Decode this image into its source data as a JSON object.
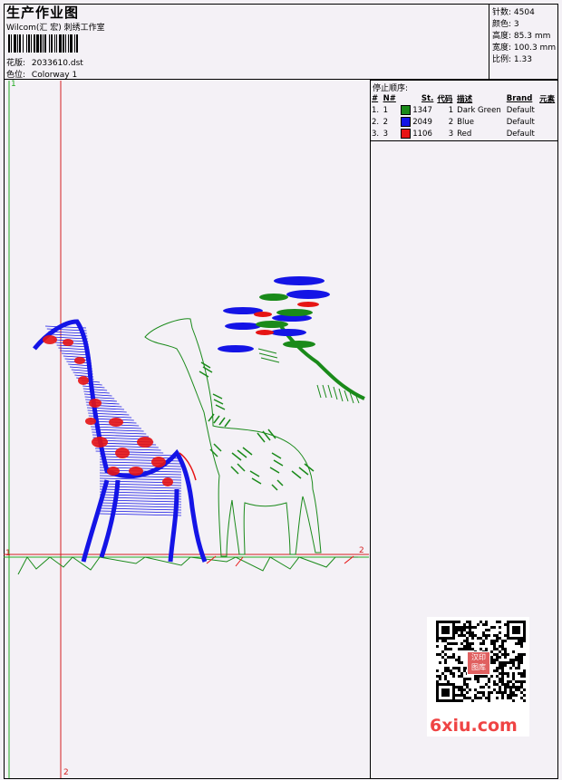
{
  "header": {
    "title": "生产作业图",
    "company": "Wilcom(汇 宏) 刺绣工作室",
    "design_file_label": "花版:",
    "design_file": "2033610.dst",
    "colorway_label": "色位:",
    "colorway": "Colorway 1"
  },
  "stats": {
    "stitches_label": "针数:",
    "stitches": "4504",
    "colors_label": "颜色:",
    "colors": "3",
    "height_label": "高度:",
    "height": "85.3 mm",
    "width_label": "宽度:",
    "width": "100.3 mm",
    "ratio_label": "比例:",
    "ratio": "1.33"
  },
  "stop_sequence": {
    "title": "停止顺序:",
    "columns": [
      "#",
      "N#",
      "St.",
      "代码",
      "描述",
      "Brand",
      "元素"
    ],
    "rows": [
      {
        "idx": "1.",
        "n": "1",
        "color": "#1a8a1a",
        "st": "1347",
        "code": "1",
        "desc": "Dark Green",
        "brand": "Default"
      },
      {
        "idx": "2.",
        "n": "2",
        "color": "#1414e6",
        "st": "2049",
        "code": "2",
        "desc": "Blue",
        "brand": "Default"
      },
      {
        "idx": "3.",
        "n": "3",
        "color": "#e61414",
        "st": "1106",
        "code": "3",
        "desc": "Red",
        "brand": "Default"
      }
    ]
  },
  "axes": {
    "top_label": "1",
    "right_label": "2",
    "left_label": "1",
    "bottom_label": "2"
  },
  "watermark": {
    "qr_badge": "汉印 图库",
    "brand": "6xiu.com"
  },
  "colors": {
    "green": "#1a8a1a",
    "blue": "#1414e6",
    "red": "#e61414",
    "guide_red": "#d42020",
    "guide_green": "#22aa22"
  }
}
